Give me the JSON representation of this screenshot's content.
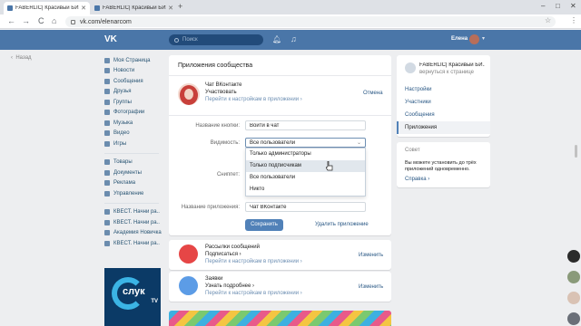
{
  "browser": {
    "tabs": [
      {
        "title": "FABERLIC| Красивый БИЗ",
        "active": true
      },
      {
        "title": "FABERLIC| Красивый БИЗ",
        "active": false
      }
    ],
    "new_tab": "+",
    "window_controls": {
      "minimize": "–",
      "maximize": "□",
      "close": "✕"
    },
    "url": "vk.com/elenarcom",
    "back": "←",
    "forward": "→",
    "reload": "C"
  },
  "vk_header": {
    "logo": "VK",
    "search_placeholder": "Поиск",
    "user_name": "Елена"
  },
  "back_link": "Назад",
  "left_menu": {
    "items": [
      "Моя Страница",
      "Новости",
      "Сообщения",
      "Друзья",
      "Группы",
      "Фотографии",
      "Музыка",
      "Видео",
      "Игры"
    ],
    "items2": [
      "Товары",
      "Документы",
      "Реклама",
      "Управление"
    ],
    "items3": [
      "КВЕСТ. Начни ра..",
      "КВЕСТ. Начни ра..",
      "Академия Новичка",
      "КВЕСТ. Начни ра.."
    ],
    "promo": {
      "brand": "слук",
      "tv": "TV"
    }
  },
  "main": {
    "title": "Приложения сообщества",
    "app": {
      "name": "Чат ВКонтакте",
      "state": "Участвовать",
      "link": "Перейти к настройкам в приложении ›",
      "cancel": "Отмена"
    },
    "form": {
      "button_name_label": "Название кнопки:",
      "button_name_value": "Войти в чат",
      "visibility_label": "Видимость:",
      "visibility_value": "Все пользователи",
      "snippet_label": "Сниппет:",
      "app_name_label": "Название приложения:",
      "app_name_value": "Чат ВКонтакте",
      "dropdown_options": [
        "Только администраторы",
        "Только подписчикам",
        "Все пользователи",
        "Никто"
      ],
      "save": "Сохранить",
      "delete": "Удалить приложение"
    }
  },
  "cards": [
    {
      "line1": "Рассылки сообщений",
      "line2": "Подписаться ›",
      "line3": "Перейти к настройкам в приложении ›",
      "action": "Изменить",
      "color": "#e64646"
    },
    {
      "line1": "Заявки",
      "line2": "Узнать подробнее ›",
      "line3": "Перейти к настройкам в приложении ›",
      "action": "Изменить",
      "color": "#5c9ce6"
    }
  ],
  "right_nav": {
    "group_title": "FABERLIC| Красивый БИ..",
    "group_sub": "вернуться к странице",
    "items": [
      "Настройки",
      "Участники",
      "Сообщения",
      "Приложения"
    ],
    "active_index": 3
  },
  "tip": {
    "title": "Совет",
    "body": "Вы можете установить до трёх приложений одновременно.",
    "link": "Справка ›"
  }
}
